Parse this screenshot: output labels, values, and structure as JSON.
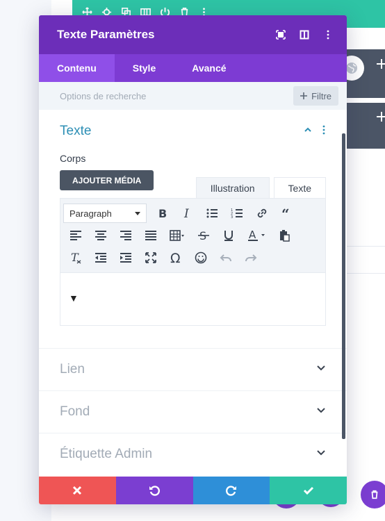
{
  "background": {
    "row_icons": [
      "move-icon",
      "gear-icon",
      "duplicate-icon",
      "columns-icon",
      "power-icon",
      "trash-icon",
      "more-icon"
    ]
  },
  "modal": {
    "title": "Texte Paramètres",
    "header_icons": [
      "fullscreen-icon",
      "split-view-icon",
      "more-icon"
    ],
    "tabs": [
      {
        "label": "Contenu",
        "active": true
      },
      {
        "label": "Style",
        "active": false
      },
      {
        "label": "Avancé",
        "active": false
      }
    ],
    "search": {
      "placeholder": "Options de recherche",
      "filter_label": "Filtre"
    },
    "text_section": {
      "title": "Texte",
      "body_label": "Corps",
      "add_media_label": "AJOUTER MÉDIA",
      "editor_tabs": [
        {
          "label": "Illustration",
          "active": false
        },
        {
          "label": "Texte",
          "active": true
        }
      ],
      "format_select": "Paragraph",
      "cursor_glyph": "▼"
    },
    "closed_sections": [
      {
        "label": "Lien"
      },
      {
        "label": "Fond"
      },
      {
        "label": "Étiquette Admin"
      }
    ],
    "footer": {
      "colors": {
        "cancel": "#ef5555",
        "undo": "#7b3ed1",
        "redo": "#2e8fd8",
        "save": "#2ec4a5"
      }
    }
  },
  "colors": {
    "header": "#6c2eb9",
    "tabs": "#7d3bd3",
    "accent": "#2d8fb5"
  }
}
